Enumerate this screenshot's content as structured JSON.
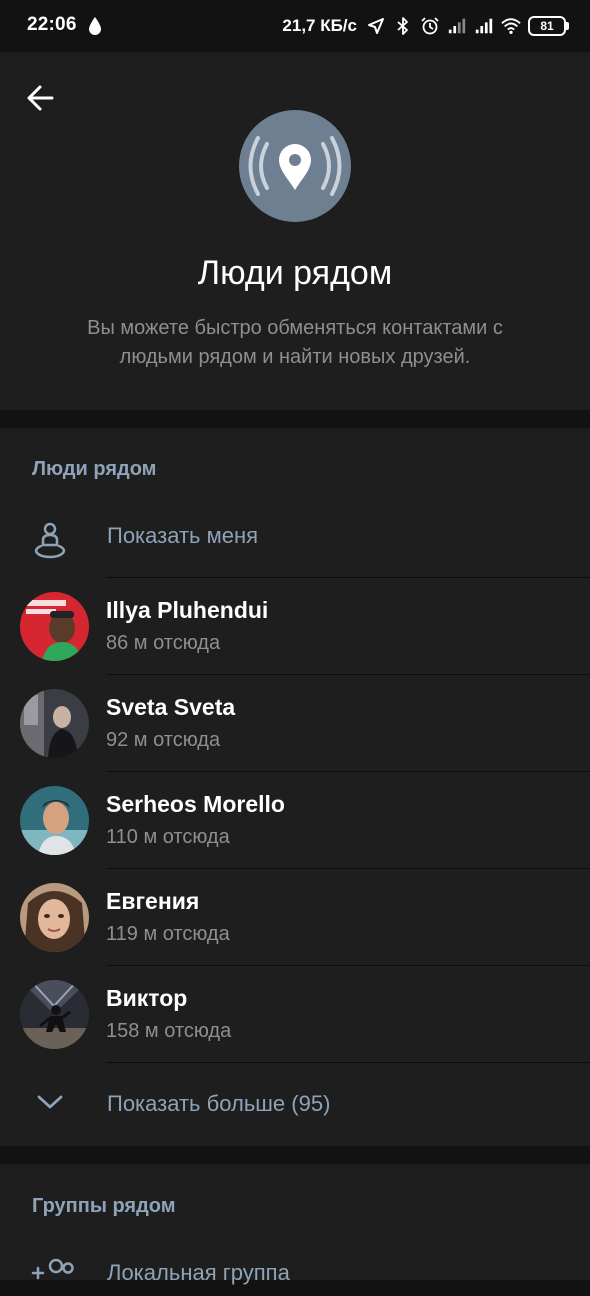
{
  "status_bar": {
    "time": "22:06",
    "speed": "21,7 КБ/с",
    "battery": "81",
    "icons": [
      "location-arrow-icon",
      "bluetooth-icon",
      "alarm-icon",
      "signal-icon",
      "signal-icon",
      "wifi-icon",
      "battery-icon"
    ]
  },
  "header": {
    "title": "Люди рядом",
    "description": "Вы можете быстро обменяться контактами с людьми рядом и найти новых друзей."
  },
  "people_section": {
    "title": "Люди рядом",
    "show_me_label": "Показать меня",
    "people": [
      {
        "name": "Illya Pluhendui",
        "distance": "86 м отсюда"
      },
      {
        "name": "Sveta Sveta",
        "distance": "92 м отсюда"
      },
      {
        "name": "Serheos Morello",
        "distance": "110 м отсюда"
      },
      {
        "name": "Евгения",
        "distance": "119 м отсюда"
      },
      {
        "name": "Виктор",
        "distance": "158 м отсюда"
      }
    ],
    "show_more_label": "Показать больше (95)"
  },
  "groups_section": {
    "title": "Группы рядом",
    "local_group_label": "Локальная группа"
  },
  "colors": {
    "background": "#121212",
    "surface": "#1e1e1e",
    "accent": "#8fa3b8",
    "hero_circle": "#6e7f91",
    "secondary_text": "#8e8e93"
  }
}
